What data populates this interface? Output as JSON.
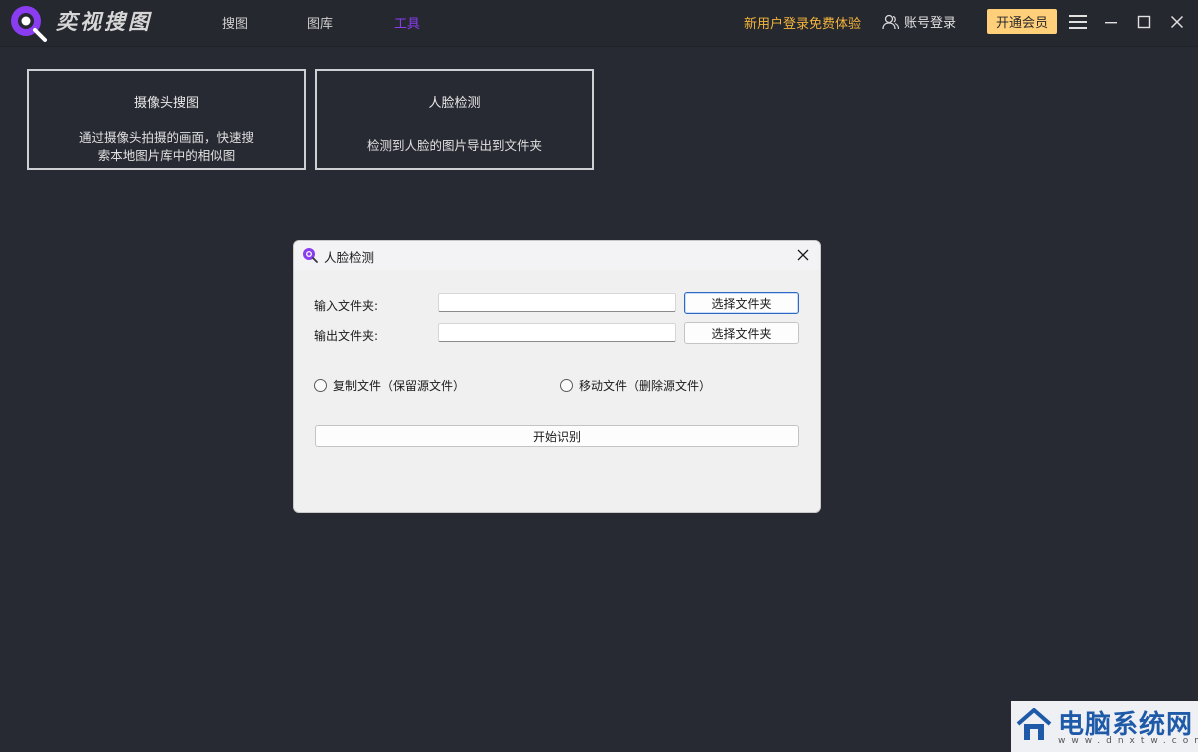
{
  "app": {
    "name": "奕视搜图"
  },
  "nav": {
    "items": [
      "搜图",
      "图库",
      "工具"
    ],
    "active_index": 2
  },
  "header": {
    "promo": "新用户登录免费体验",
    "login": "账号登录",
    "vip": "开通会员",
    "icons": [
      "user-icon",
      "menu-icon",
      "minimize-icon",
      "maximize-icon",
      "close-icon"
    ]
  },
  "cards": [
    {
      "title": "摄像头搜图",
      "desc": "通过摄像头拍摄的画面，快速搜索本地图片库中的相似图"
    },
    {
      "title": "人脸检测",
      "desc": "检测到人脸的图片导出到文件夹"
    }
  ],
  "dialog": {
    "title": "人脸检测",
    "input_label": "输入文件夹:",
    "input_value": "",
    "output_label": "输出文件夹:",
    "output_value": "",
    "browse_label": "选择文件夹",
    "radio_copy": "复制文件（保留源文件）",
    "radio_move": "移动文件（删除源文件）",
    "start_label": "开始识别"
  },
  "watermark": {
    "text": "电脑系统网",
    "url": "www.dnxtw.com"
  },
  "colors": {
    "accent": "#8a3cf0",
    "promo": "#f5b53a",
    "vip": "#ffcf7a",
    "background": "#282a33"
  }
}
